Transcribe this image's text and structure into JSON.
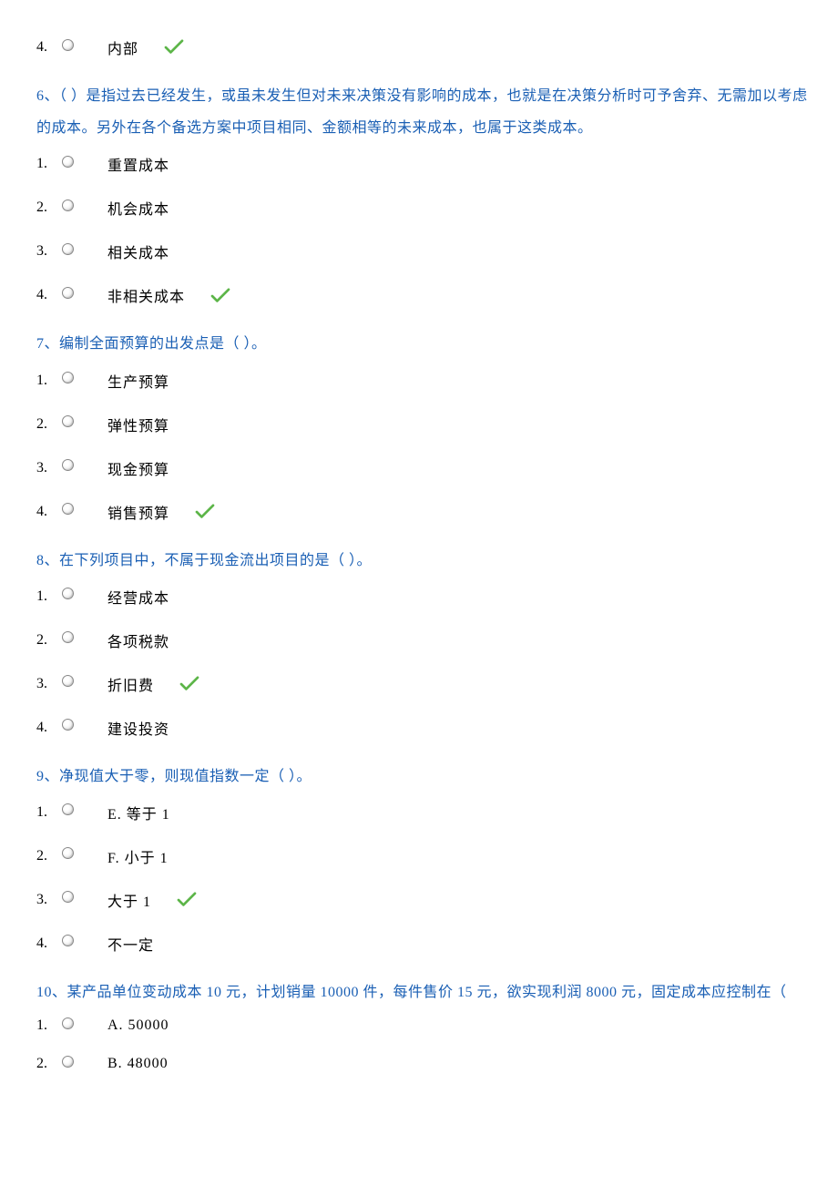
{
  "q5_tail": {
    "option4": {
      "num": "4.",
      "text": "内部",
      "correct": true
    }
  },
  "q6": {
    "prompt": "6、（                  ）是指过去已经发生，或虽未发生但对未来决策没有影响的成本，也就是在决策分析时可予舍弃、无需加以考虑的成本。另外在各个备选方案中项目相同、金额相等的未来成本，也属于这类成本。",
    "options": [
      {
        "num": "1.",
        "text": "重置成本",
        "correct": false
      },
      {
        "num": "2.",
        "text": "机会成本",
        "correct": false
      },
      {
        "num": "3.",
        "text": "相关成本",
        "correct": false
      },
      {
        "num": "4.",
        "text": "非相关成本",
        "correct": true
      }
    ]
  },
  "q7": {
    "prompt": "7、编制全面预算的出发点是（                    ）。",
    "options": [
      {
        "num": "1.",
        "text": "生产预算",
        "correct": false
      },
      {
        "num": "2.",
        "text": "弹性预算",
        "correct": false
      },
      {
        "num": "3.",
        "text": "现金预算",
        "correct": false
      },
      {
        "num": "4.",
        "text": "销售预算",
        "correct": true
      }
    ]
  },
  "q8": {
    "prompt": "8、在下列项目中，不属于现金流出项目的是（                  ）。",
    "options": [
      {
        "num": "1.",
        "text": "经营成本",
        "correct": false
      },
      {
        "num": "2.",
        "text": "各项税款",
        "correct": false
      },
      {
        "num": "3.",
        "text": "折旧费",
        "correct": true
      },
      {
        "num": "4.",
        "text": "建设投资",
        "correct": false
      }
    ]
  },
  "q9": {
    "prompt": "9、净现值大于零，则现值指数一定（                  ）。",
    "options": [
      {
        "num": "1.",
        "text": "E. 等于 1",
        "correct": false
      },
      {
        "num": "2.",
        "text": "F. 小于 1",
        "correct": false
      },
      {
        "num": "3.",
        "text": "大于 1",
        "correct": true
      },
      {
        "num": "4.",
        "text": "不一定",
        "correct": false
      }
    ]
  },
  "q10": {
    "prompt": "10、某产品单位变动成本 10 元，计划销量 10000 件，每件售价 15 元，欲实现利润 8000 元，固定成本应控制在（",
    "options_partial": [
      {
        "num": "1.",
        "text": "A. 50000",
        "correct": false
      },
      {
        "num": "2.",
        "text": "B. 48000",
        "correct": false
      }
    ]
  }
}
